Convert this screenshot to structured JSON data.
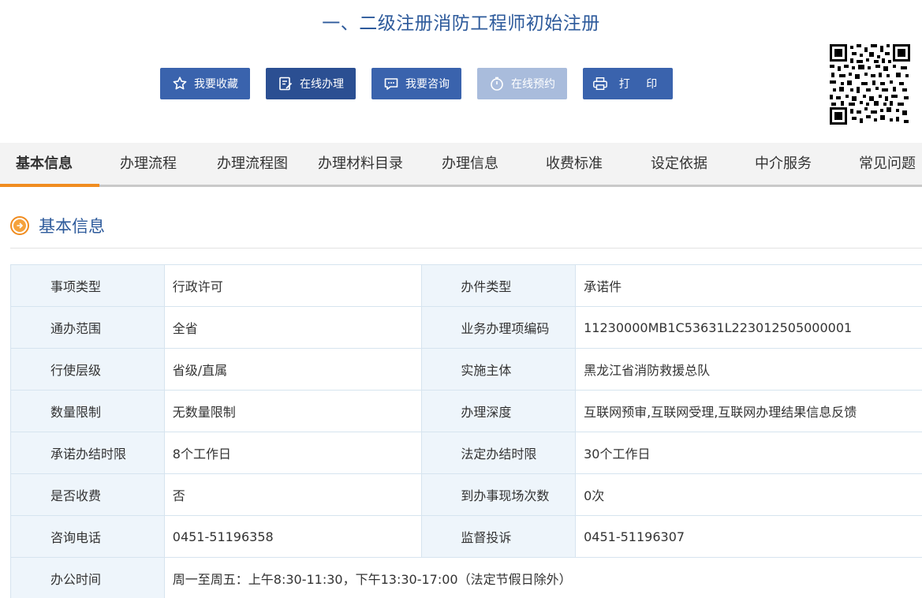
{
  "page": {
    "title": "一、二级注册消防工程师初始注册"
  },
  "actions": {
    "favorite": "我要收藏",
    "online": "在线办理",
    "consult": "我要咨询",
    "reserve": "在线预约",
    "print": "打 印"
  },
  "tabs": [
    {
      "label": "基本信息",
      "active": true
    },
    {
      "label": "办理流程"
    },
    {
      "label": "办理流程图"
    },
    {
      "label": "办理材料目录"
    },
    {
      "label": "办理信息"
    },
    {
      "label": "收费标准"
    },
    {
      "label": "设定依据"
    },
    {
      "label": "中介服务"
    },
    {
      "label": "常见问题"
    }
  ],
  "section": {
    "title": "基本信息"
  },
  "info": {
    "rows": [
      {
        "l1": "事项类型",
        "v1": "行政许可",
        "l2": "办件类型",
        "v2": "承诺件"
      },
      {
        "l1": "通办范围",
        "v1": "全省",
        "l2": "业务办理项编码",
        "v2": "11230000MB1C53631L223012505000001"
      },
      {
        "l1": "行使层级",
        "v1": "省级/直属",
        "l2": "实施主体",
        "v2": "黑龙江省消防救援总队"
      },
      {
        "l1": "数量限制",
        "v1": "无数量限制",
        "l2": "办理深度",
        "v2": "互联网预审,互联网受理,互联网办理结果信息反馈"
      },
      {
        "l1": "承诺办结时限",
        "v1": "8个工作日",
        "l2": "法定办结时限",
        "v2": "30个工作日"
      },
      {
        "l1": "是否收费",
        "v1": "否",
        "l2": "到办事现场次数",
        "v2": "0次"
      },
      {
        "l1": "咨询电话",
        "v1": "0451-51196358",
        "l2": "监督投诉",
        "v2": "0451-51196307"
      }
    ],
    "office_hours_label": "办公时间",
    "office_hours_value": "周一至周五：上午8:30-11:30，下午13:30-17:00（法定节假日除外）"
  },
  "colors": {
    "primary": "#3a63ad",
    "accent": "#f08c1f",
    "title": "#2d5a9b"
  },
  "icons": {
    "favorite": "star-icon",
    "online": "edit-form-icon",
    "consult": "chat-icon",
    "reserve": "clock-icon",
    "print": "printer-icon",
    "section": "arrow-circle-icon",
    "qr": "qr-code-icon"
  }
}
